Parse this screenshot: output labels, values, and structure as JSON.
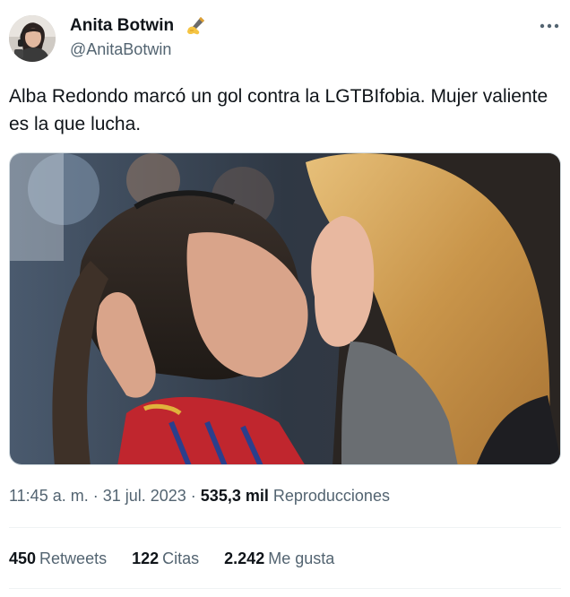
{
  "author": {
    "name": "Anita Botwin",
    "handle": "@AnitaBotwin",
    "name_emoji": "writing-hand-emoji",
    "avatar": "profile-photo"
  },
  "menu": {
    "icon": "more-horizontal-icon"
  },
  "tweet": {
    "text": "Alba Redondo marcó un gol contra la LGTBIfobia. Mujer valiente es la que lucha.",
    "media": "photo-two-women-kissing-at-stadium"
  },
  "meta": {
    "time": "11:45 a. m.",
    "separator": "·",
    "date": "31 jul. 2023",
    "views_count": "535,3 mil",
    "views_label": "Reproducciones"
  },
  "stats": [
    {
      "count": "450",
      "label": "Retweets"
    },
    {
      "count": "122",
      "label": "Citas"
    },
    {
      "count": "2.242",
      "label": "Me gusta"
    }
  ],
  "colors": {
    "text_primary": "#0f1419",
    "text_secondary": "#536471",
    "divider": "#eff3f4",
    "border": "#cfd9de"
  }
}
